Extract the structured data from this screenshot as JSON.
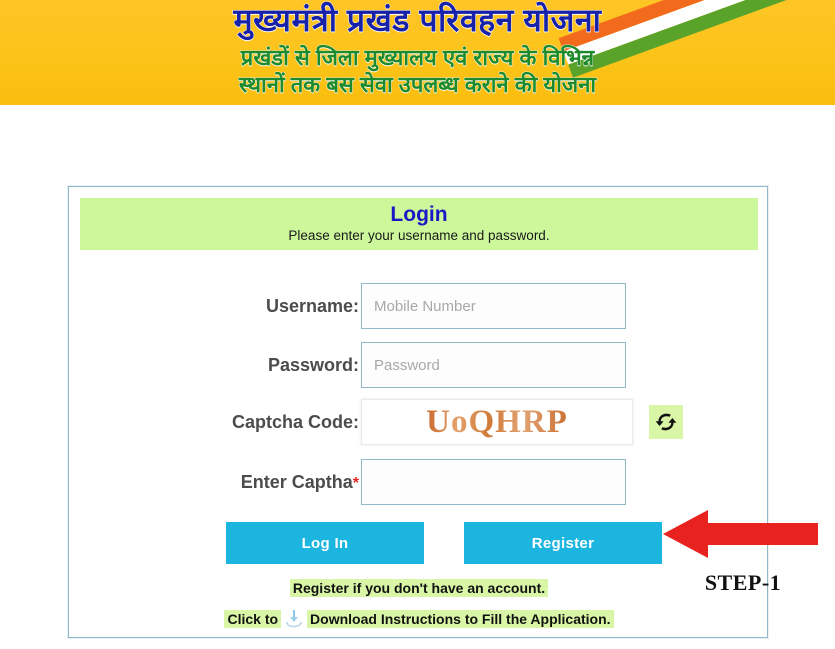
{
  "banner": {
    "title_main": "मुख्यमंत्री प्रखंड परिवहन योजना",
    "title_sub_line1": "प्रखंडों से जिला मुख्यालय एवं राज्य के विभिन्न",
    "title_sub_line2": "स्थानों तक बस सेवा उपलब्ध कराने की योजना",
    "colors": {
      "background": "#fcc419",
      "title_main_color": "#1822a8",
      "title_sub_color": "#1d8a2b",
      "flag_saffron": "#f26a1b",
      "flag_white": "#ffffff",
      "flag_green": "#5aa32a"
    }
  },
  "card": {
    "header": {
      "title": "Login",
      "subtitle": "Please enter your username and password.",
      "background": "#ccf79a",
      "title_color": "#1a18c4"
    },
    "fields": {
      "username": {
        "label": "Username:",
        "placeholder": "Mobile Number",
        "value": ""
      },
      "password": {
        "label": "Password:",
        "placeholder": "Password",
        "value": ""
      },
      "captcha_code": {
        "label": "Captcha Code:",
        "code": "UoQHRP",
        "code_color": "#d9812f",
        "refresh_icon": "refresh-icon"
      },
      "enter_captcha": {
        "label": "Enter Captha",
        "required_marker": "*",
        "placeholder": "",
        "value": ""
      }
    },
    "buttons": {
      "login": "Log In",
      "register": "Register",
      "color": "#1cb5e0"
    },
    "notes": {
      "line1": "Register if you don't have an account.",
      "line2_prefix": "Click to",
      "line2_icon": "download-icon",
      "line2_suffix": "Download Instructions to Fill the Application.",
      "highlight_color": "#d9f5a6"
    },
    "border_color": "#8fb8c8"
  },
  "annotation": {
    "arrow_icon": "left-arrow-icon",
    "arrow_color": "#e8221f",
    "step_label": "STEP-1"
  }
}
